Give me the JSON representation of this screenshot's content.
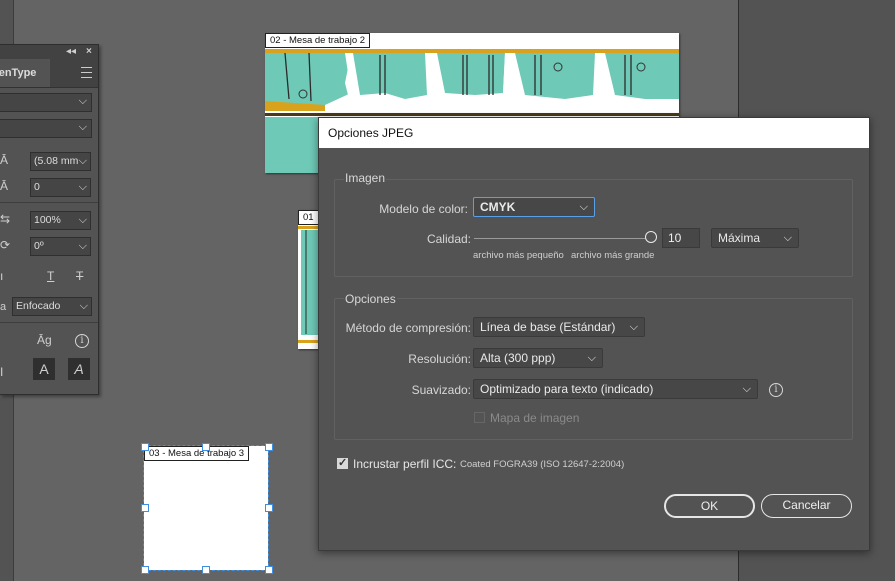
{
  "artboards": {
    "ab2_label": "02 - Mesa de trabajo 2",
    "ab1_label": "01",
    "ab3_label": "03 - Mesa de trabajo 3"
  },
  "panel": {
    "tab_label": "penType",
    "leading_value": "(5.08 mm",
    "kerning_value": "0",
    "scale_value": "100%",
    "rotation_value": "0º",
    "antialias_value": "Enfocado",
    "antialias_prefix": "a"
  },
  "dialog": {
    "title": "Opciones JPEG",
    "image_section": {
      "title": "Imagen",
      "color_model_label": "Modelo de color:",
      "color_model_value": "CMYK",
      "quality_label": "Calidad:",
      "quality_value": "10",
      "quality_level": 1.0,
      "quality_preset": "Máxima",
      "small_file_hint": "archivo más pequeño",
      "large_file_hint": "archivo más grande"
    },
    "options_section": {
      "title": "Opciones",
      "compression_label": "Método de compresión:",
      "compression_value": "Línea de base (Estándar)",
      "resolution_label": "Resolución:",
      "resolution_value": "Alta (300 ppp)",
      "antialias_label": "Suavizado:",
      "antialias_value": "Optimizado para texto (indicado)",
      "imagemap_label": "Mapa de imagen",
      "imagemap_checked": false
    },
    "icc": {
      "label": "Incrustar perfil ICC:",
      "profile": "Coated FOGRA39 (ISO 12647-2:2004)",
      "checked": true
    },
    "ok_label": "OK",
    "cancel_label": "Cancelar"
  }
}
